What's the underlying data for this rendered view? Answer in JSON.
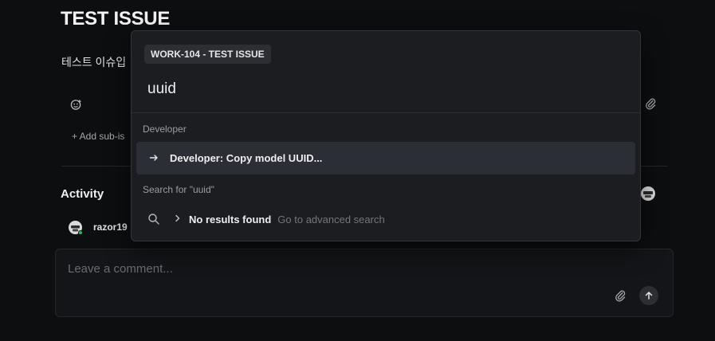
{
  "issue": {
    "title": "TEST ISSUE",
    "description": "테스트 이슈입",
    "add_sub_issue": "+ Add sub-is"
  },
  "activity": {
    "title": "Activity",
    "username": "razor19"
  },
  "comment": {
    "placeholder": "Leave a comment..."
  },
  "palette": {
    "context_chip": "WORK-104 - TEST ISSUE",
    "query": "uuid",
    "groups": [
      {
        "label": "Developer",
        "items": [
          {
            "label": "Developer: Copy model UUID...",
            "icon": "arrow-right-icon",
            "selected": true
          }
        ]
      }
    ],
    "search_label": "Search for \"uuid\"",
    "no_results": "No results found",
    "advanced_search": "Go to advanced search"
  },
  "icons": [
    "emoji-icon",
    "paperclip-icon",
    "search-icon",
    "chevron-right-icon",
    "arrow-up-icon",
    "avatar-icon"
  ],
  "colors": {
    "background": "#0d0e10",
    "palette_bg": "#1c1d21",
    "selected_row": "#2c2e35",
    "online": "#2fb85a"
  }
}
